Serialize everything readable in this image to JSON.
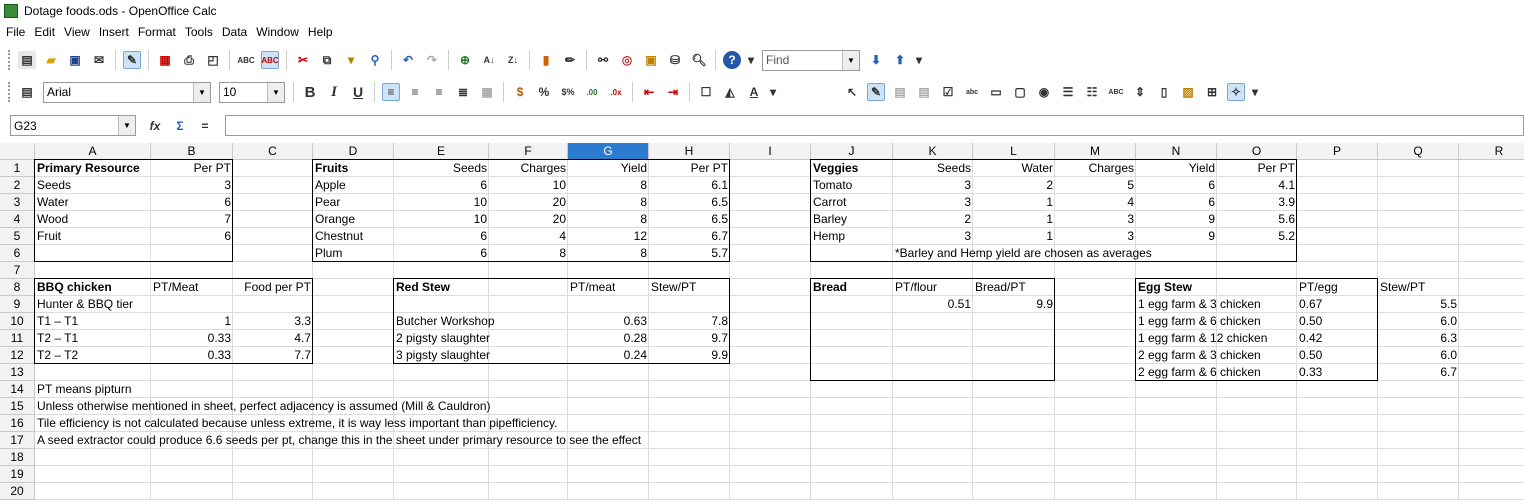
{
  "window": {
    "title": "Dotage foods.ods - OpenOffice Calc"
  },
  "menu": [
    "File",
    "Edit",
    "View",
    "Insert",
    "Format",
    "Tools",
    "Data",
    "Window",
    "Help"
  ],
  "toolbar": {
    "find_placeholder": "Find",
    "font_name": "Arial",
    "font_size": "10"
  },
  "formula_bar": {
    "cell_ref": "G23",
    "formula": ""
  },
  "selected_column": "G",
  "columns": [
    "A",
    "B",
    "C",
    "D",
    "E",
    "F",
    "G",
    "H",
    "I",
    "J",
    "K",
    "L",
    "M",
    "N",
    "O",
    "P",
    "Q",
    "R"
  ],
  "row_count": 20,
  "cells": [
    {
      "r": "A1",
      "v": "Primary Resource",
      "b": 1
    },
    {
      "r": "B1",
      "v": "Per PT",
      "a": "r"
    },
    {
      "r": "A2",
      "v": "Seeds"
    },
    {
      "r": "B2",
      "v": "3",
      "a": "r"
    },
    {
      "r": "A3",
      "v": "Water"
    },
    {
      "r": "B3",
      "v": "6",
      "a": "r"
    },
    {
      "r": "A4",
      "v": "Wood"
    },
    {
      "r": "B4",
      "v": "7",
      "a": "r"
    },
    {
      "r": "A5",
      "v": "Fruit"
    },
    {
      "r": "B5",
      "v": "6",
      "a": "r"
    },
    {
      "r": "D1",
      "v": "Fruits",
      "b": 1
    },
    {
      "r": "E1",
      "v": "Seeds",
      "a": "r"
    },
    {
      "r": "F1",
      "v": "Charges",
      "a": "r"
    },
    {
      "r": "G1",
      "v": "Yield",
      "a": "r"
    },
    {
      "r": "H1",
      "v": "Per PT",
      "a": "r"
    },
    {
      "r": "D2",
      "v": "Apple"
    },
    {
      "r": "E2",
      "v": "6",
      "a": "r"
    },
    {
      "r": "F2",
      "v": "10",
      "a": "r"
    },
    {
      "r": "G2",
      "v": "8",
      "a": "r"
    },
    {
      "r": "H2",
      "v": "6.1",
      "a": "r"
    },
    {
      "r": "D3",
      "v": "Pear"
    },
    {
      "r": "E3",
      "v": "10",
      "a": "r"
    },
    {
      "r": "F3",
      "v": "20",
      "a": "r"
    },
    {
      "r": "G3",
      "v": "8",
      "a": "r"
    },
    {
      "r": "H3",
      "v": "6.5",
      "a": "r"
    },
    {
      "r": "D4",
      "v": "Orange"
    },
    {
      "r": "E4",
      "v": "10",
      "a": "r"
    },
    {
      "r": "F4",
      "v": "20",
      "a": "r"
    },
    {
      "r": "G4",
      "v": "8",
      "a": "r"
    },
    {
      "r": "H4",
      "v": "6.5",
      "a": "r"
    },
    {
      "r": "D5",
      "v": "Chestnut"
    },
    {
      "r": "E5",
      "v": "6",
      "a": "r"
    },
    {
      "r": "F5",
      "v": "4",
      "a": "r"
    },
    {
      "r": "G5",
      "v": "12",
      "a": "r"
    },
    {
      "r": "H5",
      "v": "6.7",
      "a": "r"
    },
    {
      "r": "D6",
      "v": "Plum"
    },
    {
      "r": "E6",
      "v": "6",
      "a": "r"
    },
    {
      "r": "F6",
      "v": "8",
      "a": "r"
    },
    {
      "r": "G6",
      "v": "8",
      "a": "r"
    },
    {
      "r": "H6",
      "v": "5.7",
      "a": "r"
    },
    {
      "r": "J1",
      "v": "Veggies",
      "b": 1
    },
    {
      "r": "K1",
      "v": "Seeds",
      "a": "r"
    },
    {
      "r": "L1",
      "v": "Water",
      "a": "r"
    },
    {
      "r": "M1",
      "v": "Charges",
      "a": "r"
    },
    {
      "r": "N1",
      "v": "Yield",
      "a": "r"
    },
    {
      "r": "O1",
      "v": "Per PT",
      "a": "r"
    },
    {
      "r": "J2",
      "v": "Tomato"
    },
    {
      "r": "K2",
      "v": "3",
      "a": "r"
    },
    {
      "r": "L2",
      "v": "2",
      "a": "r"
    },
    {
      "r": "M2",
      "v": "5",
      "a": "r"
    },
    {
      "r": "N2",
      "v": "6",
      "a": "r"
    },
    {
      "r": "O2",
      "v": "4.1",
      "a": "r"
    },
    {
      "r": "J3",
      "v": "Carrot"
    },
    {
      "r": "K3",
      "v": "3",
      "a": "r"
    },
    {
      "r": "L3",
      "v": "1",
      "a": "r"
    },
    {
      "r": "M3",
      "v": "4",
      "a": "r"
    },
    {
      "r": "N3",
      "v": "6",
      "a": "r"
    },
    {
      "r": "O3",
      "v": "3.9",
      "a": "r"
    },
    {
      "r": "J4",
      "v": "Barley"
    },
    {
      "r": "K4",
      "v": "2",
      "a": "r"
    },
    {
      "r": "L4",
      "v": "1",
      "a": "r"
    },
    {
      "r": "M4",
      "v": "3",
      "a": "r"
    },
    {
      "r": "N4",
      "v": "9",
      "a": "r"
    },
    {
      "r": "O4",
      "v": "5.6",
      "a": "r"
    },
    {
      "r": "J5",
      "v": "Hemp"
    },
    {
      "r": "K5",
      "v": "3",
      "a": "r"
    },
    {
      "r": "L5",
      "v": "1",
      "a": "r"
    },
    {
      "r": "M5",
      "v": "3",
      "a": "r"
    },
    {
      "r": "N5",
      "v": "9",
      "a": "r"
    },
    {
      "r": "O5",
      "v": "5.2",
      "a": "r"
    },
    {
      "r": "K6",
      "v": "*Barley and Hemp yield are chosen as averages"
    },
    {
      "r": "A8",
      "v": "BBQ chicken",
      "b": 1
    },
    {
      "r": "B8",
      "v": "PT/Meat"
    },
    {
      "r": "C8",
      "v": "Food per PT",
      "a": "r"
    },
    {
      "r": "A9",
      "v": "Hunter & BBQ tier"
    },
    {
      "r": "A10",
      "v": "T1 – T1"
    },
    {
      "r": "B10",
      "v": "1",
      "a": "r"
    },
    {
      "r": "C10",
      "v": "3.3",
      "a": "r"
    },
    {
      "r": "A11",
      "v": "T2 – T1"
    },
    {
      "r": "B11",
      "v": "0.33",
      "a": "r"
    },
    {
      "r": "C11",
      "v": "4.7",
      "a": "r"
    },
    {
      "r": "A12",
      "v": "T2 – T2"
    },
    {
      "r": "B12",
      "v": "0.33",
      "a": "r"
    },
    {
      "r": "C12",
      "v": "7.7",
      "a": "r"
    },
    {
      "r": "E8",
      "v": "Red Stew",
      "b": 1
    },
    {
      "r": "G8",
      "v": "PT/meat"
    },
    {
      "r": "H8",
      "v": "Stew/PT"
    },
    {
      "r": "E10",
      "v": "Butcher Workshop"
    },
    {
      "r": "G10",
      "v": "0.63",
      "a": "r"
    },
    {
      "r": "H10",
      "v": "7.8",
      "a": "r"
    },
    {
      "r": "E11",
      "v": "2 pigsty slaughter"
    },
    {
      "r": "G11",
      "v": "0.28",
      "a": "r"
    },
    {
      "r": "H11",
      "v": "9.7",
      "a": "r"
    },
    {
      "r": "E12",
      "v": "3 pigsty slaughter"
    },
    {
      "r": "G12",
      "v": "0.24",
      "a": "r"
    },
    {
      "r": "H12",
      "v": "9.9",
      "a": "r"
    },
    {
      "r": "J8",
      "v": "Bread",
      "b": 1
    },
    {
      "r": "K8",
      "v": "PT/flour"
    },
    {
      "r": "L8",
      "v": "Bread/PT"
    },
    {
      "r": "K9",
      "v": "0.51",
      "a": "r"
    },
    {
      "r": "L9",
      "v": "9.9",
      "a": "r"
    },
    {
      "r": "N8",
      "v": "Egg Stew",
      "b": 1
    },
    {
      "r": "P8",
      "v": "PT/egg"
    },
    {
      "r": "Q8",
      "v": "Stew/PT"
    },
    {
      "r": "N9",
      "v": "1 egg farm & 3 chicken"
    },
    {
      "r": "P9",
      "v": "0.67"
    },
    {
      "r": "Q9",
      "v": "5.5",
      "a": "r"
    },
    {
      "r": "N10",
      "v": "1 egg farm & 6 chicken"
    },
    {
      "r": "P10",
      "v": "0.50"
    },
    {
      "r": "Q10",
      "v": "6.0",
      "a": "r"
    },
    {
      "r": "N11",
      "v": "1 egg farm & 12 chicken"
    },
    {
      "r": "P11",
      "v": "0.42"
    },
    {
      "r": "Q11",
      "v": "6.3",
      "a": "r"
    },
    {
      "r": "N12",
      "v": "2 egg farm & 3 chicken"
    },
    {
      "r": "P12",
      "v": "0.50"
    },
    {
      "r": "Q12",
      "v": "6.0",
      "a": "r"
    },
    {
      "r": "N13",
      "v": "2 egg farm & 6 chicken"
    },
    {
      "r": "P13",
      "v": "0.33"
    },
    {
      "r": "Q13",
      "v": "6.7",
      "a": "r"
    },
    {
      "r": "A14",
      "v": "PT means pipturn"
    },
    {
      "r": "A15",
      "v": "Unless otherwise mentioned in sheet, perfect adjacency is assumed (Mill & Cauldron)"
    },
    {
      "r": "A16",
      "v": "Tile efficiency is not calculated because unless extreme, it is way less important than pipefficiency."
    },
    {
      "r": "A17",
      "v": "A seed extractor could produce 6.6 seeds per pt, change this in the sheet under primary resource to see the effect"
    }
  ],
  "boxes": [
    [
      "A1",
      "B6"
    ],
    [
      "D1",
      "H6"
    ],
    [
      "J1",
      "O6"
    ],
    [
      "A8",
      "C12"
    ],
    [
      "E8",
      "H12"
    ],
    [
      "J8",
      "L13"
    ],
    [
      "N8",
      "P13"
    ]
  ]
}
